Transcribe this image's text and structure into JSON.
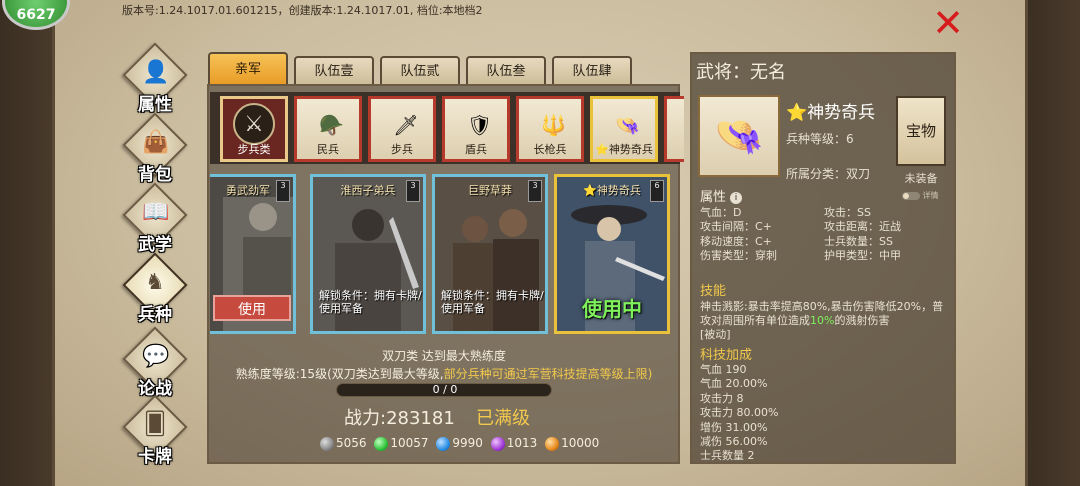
{
  "top": {
    "version_text": "版本号:1.24.1017.01.601215，创建版本:1.24.1017.01, 档位:本地档2",
    "badge_text": "6627",
    "close_icon": "close-icon"
  },
  "nav": {
    "items": [
      {
        "label": "属性",
        "icon": "person-icon",
        "glyph": "👤"
      },
      {
        "label": "背包",
        "icon": "bag-icon",
        "glyph": "👜"
      },
      {
        "label": "武学",
        "icon": "book-icon",
        "glyph": "📖"
      },
      {
        "label": "兵种",
        "icon": "horse-icon",
        "glyph": "♞"
      },
      {
        "label": "论战",
        "icon": "chat-icon",
        "glyph": "💬"
      },
      {
        "label": "卡牌",
        "icon": "cards-icon",
        "glyph": "🂠"
      }
    ],
    "active_index": 3
  },
  "tabs": [
    {
      "label": "亲军"
    },
    {
      "label": "队伍壹"
    },
    {
      "label": "队伍贰"
    },
    {
      "label": "队伍叁"
    },
    {
      "label": "队伍肆"
    }
  ],
  "unit_types": [
    {
      "label": "步兵类",
      "icon": "sword-icon",
      "glyph": "⚔"
    },
    {
      "label": "民兵",
      "icon": "militia-icon",
      "glyph": "🪖"
    },
    {
      "label": "步兵",
      "icon": "infantry-icon",
      "glyph": "🗡"
    },
    {
      "label": "盾兵",
      "icon": "shield-icon",
      "glyph": "🛡"
    },
    {
      "label": "长枪兵",
      "icon": "spear-icon",
      "glyph": "🔱"
    },
    {
      "label": "⭐神势奇兵",
      "icon": "straw-hat-icon",
      "glyph": "👒"
    }
  ],
  "soldier_cards": [
    {
      "name": "勇武劲军",
      "rank": "3",
      "button": "使用"
    },
    {
      "name": "淮西子弟兵",
      "rank": "3",
      "lock": "解锁条件：拥有卡牌/使用军备"
    },
    {
      "name": "巨野草莽",
      "rank": "3",
      "lock": "解锁条件：拥有卡牌/使用军备"
    },
    {
      "name": "⭐神势奇兵",
      "rank": "6",
      "status": "使用中"
    }
  ],
  "proficiency": {
    "title": "双刀类 达到最大熟练度",
    "level_text": "熟练度等级:15级(双刀类达到最大等级,",
    "level_hint": "部分兵种可通过军营科技提高等级上限)",
    "progress": "0 / 0"
  },
  "power": {
    "label": "战力:283181",
    "maxed": "已满级"
  },
  "currencies": [
    {
      "value": "5056",
      "color": "#8a8a8a"
    },
    {
      "value": "10057",
      "color": "#2fc43a"
    },
    {
      "value": "9990",
      "color": "#2a8fe6"
    },
    {
      "value": "1013",
      "color": "#a23ad6"
    },
    {
      "value": "10000",
      "color": "#e88a1c"
    }
  ],
  "general": {
    "title": "武将：无名",
    "unit_name": "⭐神势奇兵",
    "unit_level": "兵种等级：6",
    "category": "所属分类：双刀",
    "treasure_button": "宝物",
    "unequipped": "未装备",
    "detail_toggle": "详情"
  },
  "attributes": {
    "header": "属性",
    "rows": [
      [
        "气血：D",
        "攻击：SS"
      ],
      [
        "攻击间隔：C+",
        "攻击距离：近战"
      ],
      [
        "移动速度：C+",
        "士兵数量：SS"
      ],
      [
        "伤害类型：穿刺",
        "护甲类型：中甲"
      ]
    ]
  },
  "skill": {
    "header": "技能",
    "desc_1": "神击溅影:暴击率提高80%,暴击伤害降低20%，普攻对周围所有单位造成",
    "desc_pct": "10%",
    "desc_2": "的溅射伤害",
    "passive": "[被动]"
  },
  "tech": {
    "header": "科技加成",
    "items": [
      "气血 190",
      "气血 20.00%",
      "攻击力 8",
      "攻击力 80.00%",
      "增伤 31.00%",
      "减伤 56.00%",
      "士兵数量 2"
    ]
  }
}
